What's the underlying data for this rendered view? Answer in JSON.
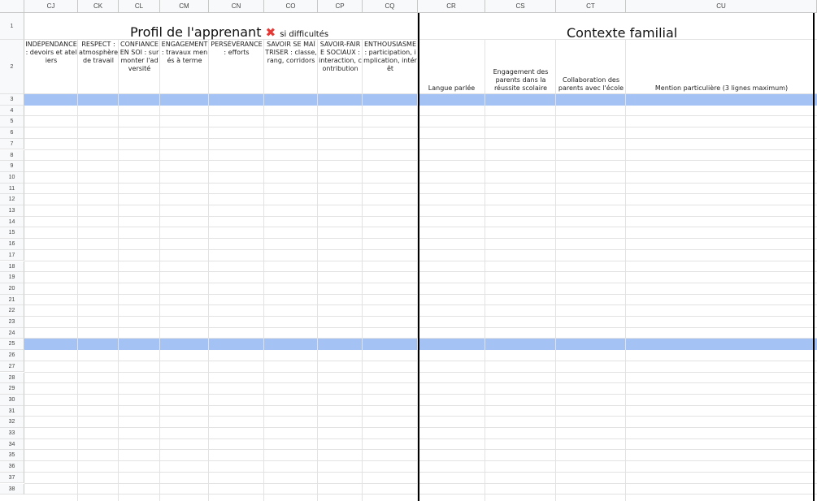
{
  "columns": [
    "CJ",
    "CK",
    "CL",
    "CM",
    "CN",
    "CO",
    "CP",
    "CQ",
    "CR",
    "CS",
    "CT",
    "CU"
  ],
  "rows": [
    "1",
    "2",
    "3",
    "4",
    "5",
    "6",
    "7",
    "8",
    "9",
    "10",
    "11",
    "12",
    "13",
    "14",
    "15",
    "16",
    "17",
    "18",
    "19",
    "20",
    "21",
    "22",
    "23",
    "24",
    "25",
    "26",
    "27",
    "28",
    "29",
    "30",
    "31",
    "32",
    "33",
    "34",
    "35",
    "36",
    "37",
    "38"
  ],
  "section_profile": {
    "title": "Profil de l'apprenant",
    "icon": "red-x-icon",
    "icon_glyph": "✖",
    "note": "si difficultés"
  },
  "section_family": {
    "title": "Contexte familial"
  },
  "profile_headers": [
    "INDÉPENDANCE : devoirs et ateliers",
    "RESPECT : atmosphère de travail",
    "CONFIANCE EN SOI : surmonter l'adversité",
    "ENGAGEMENT : travaux menés à terme",
    "PERSÉVÉRANCE : efforts",
    "SAVOIR SE MAÎTRISER : classe, rang, corridors",
    "SAVOIR-FAIRE SOCIAUX : interaction, contribution",
    "ENTHOUSIASME : participation, implication, intérêt"
  ],
  "family_headers": [
    "Langue parlée",
    "Engagement des parents dans la réussite scolaire",
    "Collaboration des parents avec l'école",
    "Mention particulière (3 lignes maximum)"
  ],
  "colors": {
    "band": "#a4c2f4",
    "icon_red": "#e53935"
  }
}
